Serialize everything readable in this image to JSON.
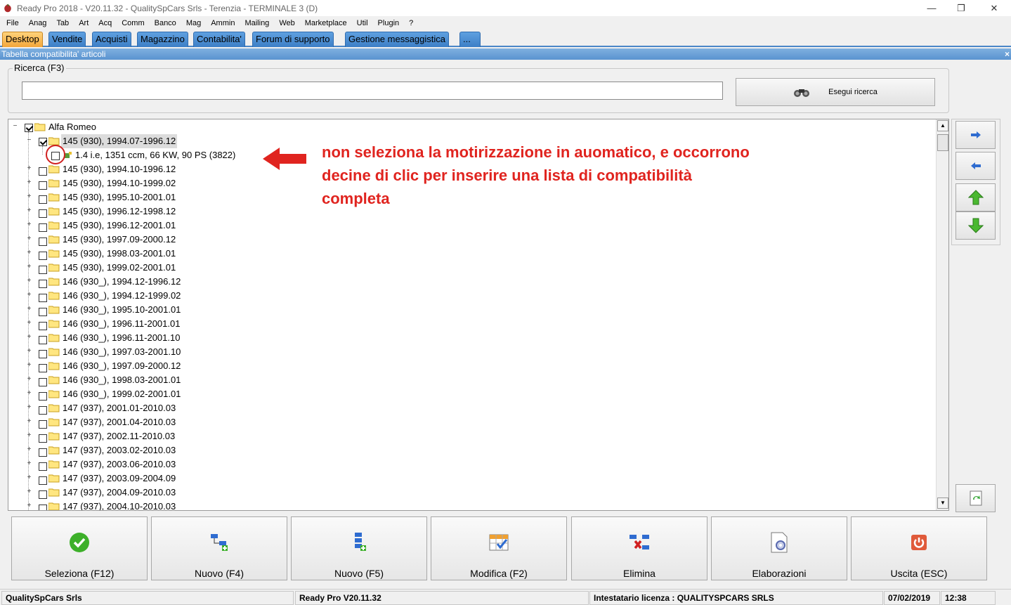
{
  "window": {
    "title": "Ready Pro 2018 - V20.11.32 - QualitySpCars Srls - Terenzia - TERMINALE 3 (D)"
  },
  "menu": [
    "File",
    "Anag",
    "Tab",
    "Art",
    "Acq",
    "Comm",
    "Banco",
    "Mag",
    "Ammin",
    "Mailing",
    "Web",
    "Marketplace",
    "Util",
    "Plugin",
    "?"
  ],
  "tabs": [
    {
      "label": "Desktop",
      "active": true
    },
    {
      "label": "Vendite"
    },
    {
      "label": "Acquisti"
    },
    {
      "label": "Magazzino"
    },
    {
      "label": "Contabilita'"
    },
    {
      "label": "Forum di supporto"
    },
    {
      "label": "Gestione messaggistica"
    },
    {
      "label": "..."
    }
  ],
  "subheader": {
    "title": "Tabella compatibilita' articoli",
    "close": "×"
  },
  "search": {
    "legend": "Ricerca (F3)",
    "value": "",
    "button": "Esegui ricerca"
  },
  "tree": {
    "root": {
      "label": "Alfa Romeo",
      "checked": true
    },
    "selected": {
      "label": "145 (930), 1994.07-1996.12",
      "checked": true
    },
    "child": {
      "label": "1.4 i.e, 1351 ccm, 66 KW, 90 PS (3822)",
      "checked": false
    },
    "items": [
      "145 (930), 1994.10-1996.12",
      "145 (930), 1994.10-1999.02",
      "145 (930), 1995.10-2001.01",
      "145 (930), 1996.12-1998.12",
      "145 (930), 1996.12-2001.01",
      "145 (930), 1997.09-2000.12",
      "145 (930), 1998.03-2001.01",
      "145 (930), 1999.02-2001.01",
      "146 (930_), 1994.12-1996.12",
      "146 (930_), 1994.12-1999.02",
      "146 (930_), 1995.10-2001.01",
      "146 (930_), 1996.11-2001.01",
      "146 (930_), 1996.11-2001.10",
      "146 (930_), 1997.03-2001.10",
      "146 (930_), 1997.09-2000.12",
      "146 (930_), 1998.03-2001.01",
      "146 (930_), 1999.02-2001.01",
      "147 (937), 2001.01-2010.03",
      "147 (937), 2001.04-2010.03",
      "147 (937), 2002.11-2010.03",
      "147 (937), 2003.02-2010.03",
      "147 (937), 2003.06-2010.03",
      "147 (937), 2003.09-2004.09",
      "147 (937), 2004.09-2010.03",
      "147 (937), 2004.10-2010.03"
    ]
  },
  "annotation": {
    "text": "non seleziona la motirizzazione in auomatico, e occorrono decine di clic per inserire una lista di compatibilità completa",
    "color": "#e0241f"
  },
  "buttons": [
    {
      "label": "Seleziona (F12)",
      "icon": "check-icon"
    },
    {
      "label": "Nuovo (F4)",
      "icon": "tree-add-icon"
    },
    {
      "label": "Nuovo (F5)",
      "icon": "list-add-icon"
    },
    {
      "label": "Modifica (F2)",
      "icon": "edit-table-icon"
    },
    {
      "label": "Elimina",
      "icon": "delete-node-icon"
    },
    {
      "label": "Elaborazioni",
      "icon": "process-icon"
    },
    {
      "label": "Uscita (ESC)",
      "icon": "exit-icon"
    }
  ],
  "status": {
    "company": "QualitySpCars Srls",
    "version": "Ready Pro V20.11.32",
    "license": "Intestatario licenza : QUALITYSPCARS SRLS",
    "date": "07/02/2019",
    "time": "12:38"
  },
  "colors": {
    "tab_active": "#f3a63a",
    "tab": "#3d7fc6",
    "accent": "#4a86c8"
  }
}
